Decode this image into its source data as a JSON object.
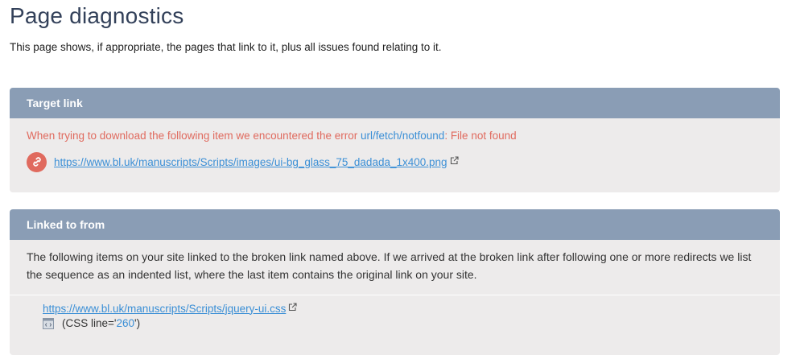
{
  "page": {
    "title": "Page diagnostics",
    "intro": "This page shows, if appropriate, the pages that link to it, plus all issues found relating to it."
  },
  "target_panel": {
    "header": "Target link",
    "error_prefix": "When trying to download the following item we encountered the error ",
    "error_code": "url/fetch/notfound",
    "error_suffix": ": File not found",
    "url": "https://www.bl.uk/manuscripts/Scripts/images/ui-bg_glass_75_dadada_1x400.png"
  },
  "linked_panel": {
    "header": "Linked to from",
    "description": "The following items on your site linked to the broken link named above. If we arrived at the broken link after following one or more redirects we list the sequence as an indented list, where the last item contains the original link on your site.",
    "source_url": "https://www.bl.uk/manuscripts/Scripts/jquery-ui.css",
    "css_line_prefix": "(CSS line='",
    "css_line_number": "260",
    "css_line_suffix": "')"
  },
  "colors": {
    "header_bg": "#8a9db5",
    "panel_bg": "#edebeb",
    "error": "#e06a5e",
    "link": "#3b8fd6"
  },
  "icons": {
    "broken_link_badge": "broken-link-icon",
    "external": "external-link-icon",
    "css_file": "css-file-icon"
  }
}
